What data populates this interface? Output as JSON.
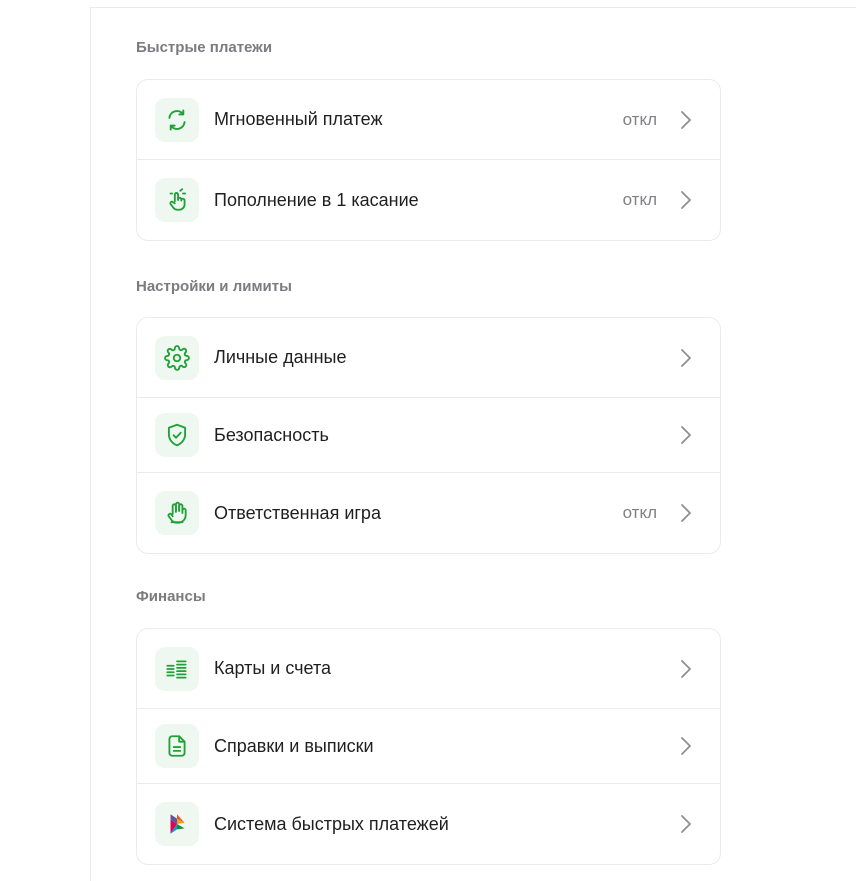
{
  "sections": [
    {
      "title": "Быстрые платежи",
      "items": [
        {
          "label": "Мгновенный платеж",
          "status": "откл",
          "icon": "sync-arrows-icon"
        },
        {
          "label": "Пополнение в 1 касание",
          "status": "откл",
          "icon": "tap-hand-icon"
        }
      ]
    },
    {
      "title": "Настройки и лимиты",
      "items": [
        {
          "label": "Личные данные",
          "status": "",
          "icon": "gear-icon"
        },
        {
          "label": "Безопасность",
          "status": "",
          "icon": "shield-check-icon"
        },
        {
          "label": "Ответственная игра",
          "status": "откл",
          "icon": "hand-stop-icon"
        }
      ]
    },
    {
      "title": "Финансы",
      "items": [
        {
          "label": "Карты и счета",
          "status": "",
          "icon": "coin-stacks-icon"
        },
        {
          "label": "Справки и выписки",
          "status": "",
          "icon": "document-icon"
        },
        {
          "label": "Система быстрых платежей",
          "status": "",
          "icon": "sbp-logo-icon"
        }
      ]
    }
  ],
  "colors": {
    "accent": "#21a038",
    "icon_bg": "#eef8f0",
    "border": "#ebebee",
    "section_title": "#7b7b80",
    "status": "#808085",
    "chevron": "#8e8e93"
  }
}
